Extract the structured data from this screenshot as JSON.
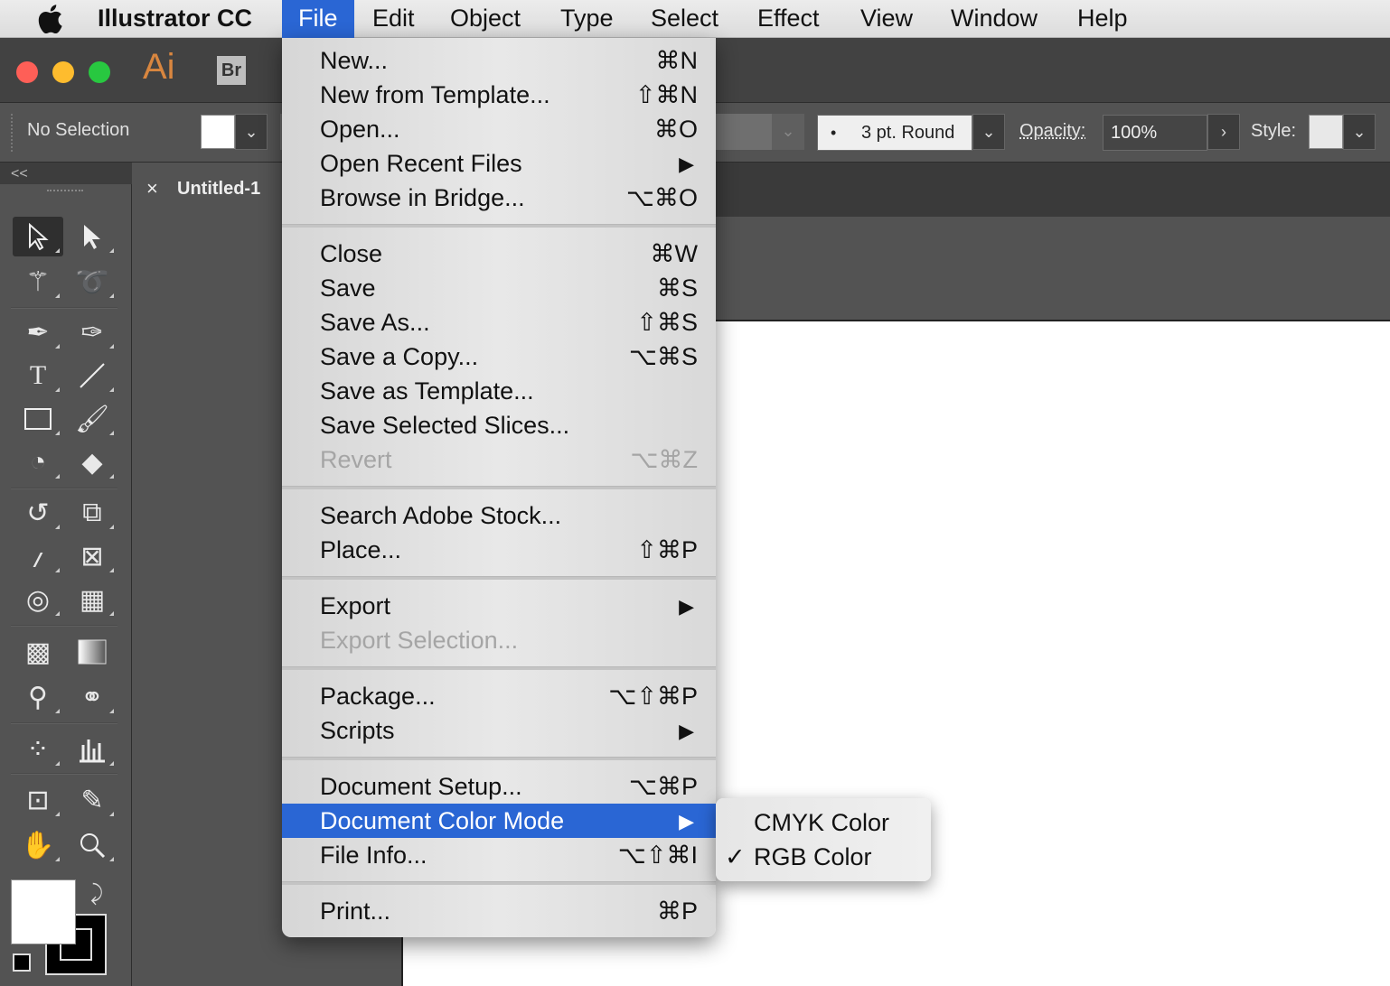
{
  "menubar": {
    "app_name": "Illustrator CC",
    "items": [
      {
        "label": "File",
        "active": true
      },
      {
        "label": "Edit"
      },
      {
        "label": "Object"
      },
      {
        "label": "Type"
      },
      {
        "label": "Select"
      },
      {
        "label": "Effect"
      },
      {
        "label": "View"
      },
      {
        "label": "Window"
      },
      {
        "label": "Help"
      }
    ]
  },
  "window": {
    "app_logo": "Ai",
    "bridge_button": "Br",
    "traffic_colors": {
      "close": "#fe5f57",
      "minimize": "#febc2e",
      "zoom": "#28c840"
    }
  },
  "control_bar": {
    "selection_status": "No Selection",
    "stroke_profile_label": "3 pt. Round",
    "opacity_label": "Opacity:",
    "opacity_value": "100%",
    "style_label": "Style:"
  },
  "document": {
    "tab_close": "×",
    "tab_name": "Untitled-1"
  },
  "tools": {
    "collapse": "<<",
    "icons": [
      "selection-tool",
      "direct-selection-tool",
      "magic-wand-tool",
      "lasso-tool",
      "pen-tool",
      "curvature-tool",
      "type-tool",
      "line-tool",
      "rectangle-tool",
      "paintbrush-tool",
      "shaper-tool",
      "eraser-tool",
      "rotate-tool",
      "scale-tool",
      "warp-tool",
      "free-transform-tool",
      "shape-builder-tool",
      "perspective-grid-tool",
      "mesh-tool",
      "gradient-tool",
      "eyedropper-tool",
      "blend-tool",
      "symbol-sprayer-tool",
      "column-graph-tool",
      "artboard-tool",
      "slice-tool",
      "hand-tool",
      "zoom-tool"
    ]
  },
  "file_menu": {
    "items": [
      {
        "label": "New...",
        "shortcut": "⌘N"
      },
      {
        "label": "New from Template...",
        "shortcut": "⇧⌘N"
      },
      {
        "label": "Open...",
        "shortcut": "⌘O"
      },
      {
        "label": "Open Recent Files",
        "submenu": "▶"
      },
      {
        "label": "Browse in Bridge...",
        "shortcut": "⌥⌘O"
      },
      {
        "label": "Close",
        "shortcut": "⌘W"
      },
      {
        "label": "Save",
        "shortcut": "⌘S"
      },
      {
        "label": "Save As...",
        "shortcut": "⇧⌘S"
      },
      {
        "label": "Save a Copy...",
        "shortcut": "⌥⌘S"
      },
      {
        "label": "Save as Template..."
      },
      {
        "label": "Save Selected Slices..."
      },
      {
        "label": "Revert",
        "shortcut": "⌥⌘Z",
        "disabled": true
      },
      {
        "label": "Search Adobe Stock..."
      },
      {
        "label": "Place...",
        "shortcut": "⇧⌘P"
      },
      {
        "label": "Export",
        "submenu": "▶"
      },
      {
        "label": "Export Selection...",
        "disabled": true
      },
      {
        "label": "Package...",
        "shortcut": "⌥⇧⌘P"
      },
      {
        "label": "Scripts",
        "submenu": "▶"
      },
      {
        "label": "Document Setup...",
        "shortcut": "⌥⌘P"
      },
      {
        "label": "Document Color Mode",
        "submenu": "▶",
        "highlighted": true
      },
      {
        "label": "File Info...",
        "shortcut": "⌥⇧⌘I"
      },
      {
        "label": "Print...",
        "shortcut": "⌘P"
      }
    ]
  },
  "color_mode_submenu": {
    "items": [
      {
        "label": "CMYK Color",
        "check": ""
      },
      {
        "label": "RGB Color",
        "check": "✓"
      }
    ]
  },
  "colors": {
    "highlight": "#2a66d4",
    "ai_brand": "#d8863f"
  }
}
